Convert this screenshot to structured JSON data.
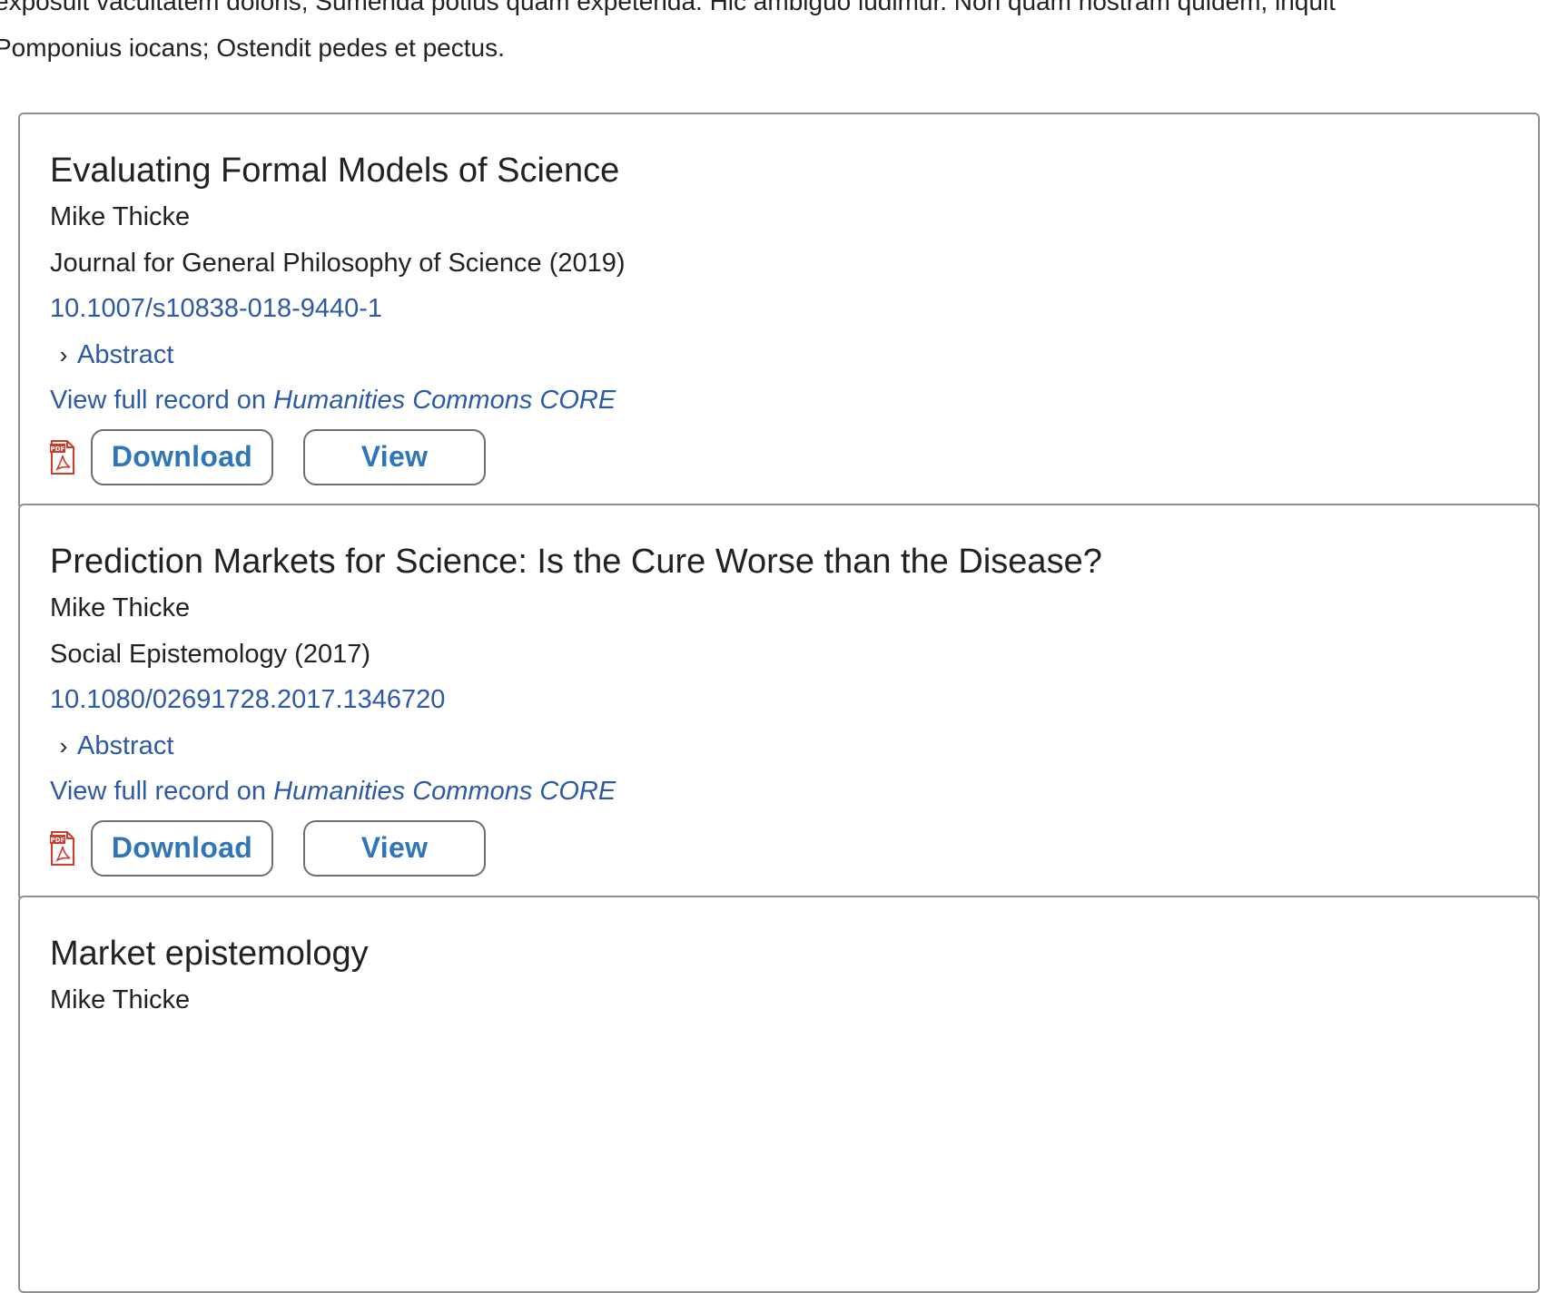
{
  "intro": {
    "line1": "exposuit vacuitatem doloris; Sumenda potius quam expetenda. Hic ambiguo ludimur. Non quam nostram quidem, inquit",
    "line2": "Pomponius iocans; Ostendit pedes et pectus."
  },
  "records": [
    {
      "title": "Evaluating Formal Models of Science",
      "author": "Mike Thicke",
      "journal": "Journal for General Philosophy of Science (2019)",
      "doi": "10.1007/s10838-018-9440-1",
      "abstract_label": "Abstract",
      "record_prefix": "View full record on ",
      "record_source": "Humanities Commons CORE",
      "download_label": "Download",
      "view_label": "View"
    },
    {
      "title": "Prediction Markets for Science: Is the Cure Worse than the Disease?",
      "author": "Mike Thicke",
      "journal": "Social Epistemology (2017)",
      "doi": "10.1080/02691728.2017.1346720",
      "abstract_label": "Abstract",
      "record_prefix": "View full record on ",
      "record_source": "Humanities Commons CORE",
      "download_label": "Download",
      "view_label": "View"
    },
    {
      "title": "Market epistemology",
      "author": "Mike Thicke"
    }
  ],
  "icons": {
    "chevron": "chevron-right-icon",
    "pdf": "pdf-file-icon"
  },
  "colors": {
    "link": "#2d5aa6",
    "button_text": "#2f76b8",
    "pdf_red": "#d03a2c",
    "border": "#8f8f8f"
  }
}
